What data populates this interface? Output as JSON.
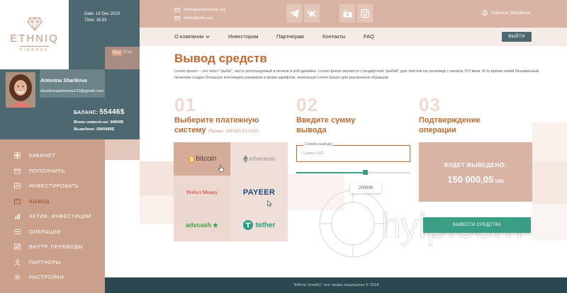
{
  "brand": {
    "name": "ETHNIQ",
    "sub": "FINANCE"
  },
  "session": {
    "date": "Date: 14 Dec 2020",
    "time": "Time: 16:33"
  },
  "lang": {
    "ru": "Rus",
    "en": "Eng"
  },
  "user": {
    "name": "Antonina Sharikova",
    "email": "sharikovaantonina123@gmail.com",
    "balance_label": "БАЛАНС:",
    "balance_value": "55446$",
    "invested": "Всего инвест-но: 94849$",
    "withdrawn": "Выведено: 5945485$"
  },
  "sidebar": {
    "items": [
      {
        "label": "КАБИНЕТ",
        "icon": "grid-icon"
      },
      {
        "label": "ПОПОЛНИТЬ",
        "icon": "deposit-icon"
      },
      {
        "label": "ИНВЕСТИРОВАТЬ",
        "icon": "invest-icon"
      },
      {
        "label": "ВЫВОД",
        "icon": "withdraw-icon"
      },
      {
        "label": "АКТИВ. ИНВЕСТИЦИИ",
        "icon": "chart-icon"
      },
      {
        "label": "ОПЕРАЦИИ",
        "icon": "list-icon"
      },
      {
        "label": "ВНУТР. ПЕРЕВОДЫ",
        "icon": "transfer-icon"
      },
      {
        "label": "ПАРТНЕРЫ",
        "icon": "partners-icon"
      },
      {
        "label": "НАСТРОЙКИ",
        "icon": "settings-icon"
      }
    ]
  },
  "header": {
    "email1": "ethniqjewelrycoinfo.org",
    "email2": "ethniq@info.org",
    "social": [
      "telegram-icon",
      "vk-icon",
      "youtube-icon",
      "instagram-icon"
    ],
    "user_name": "Antonina Sharikova"
  },
  "nav": {
    "items": [
      "О компании",
      "Инвесторам",
      "Партнерам",
      "Контакты",
      "FAQ"
    ],
    "logout": "ВЫЙТИ"
  },
  "page": {
    "title": "Вывод средств",
    "intro": "Lorem Ipsum – это текст-\"рыба\", часто используемый в печати и вэб-дизайне. Lorem Ipsum является стандартной \"рыбой\" для текстов на латинице с начала XVI века. В то время некий безымянный печатник создал большую коллекцию размеров и форм шрифтов, используя Lorem Ipsum для распечатки образцов."
  },
  "steps": [
    {
      "num": "01",
      "title": "Выберите платежную",
      "title2": "систему",
      "hint": "(баланс: 198 801,93 USD)"
    },
    {
      "num": "02",
      "title": "Введите сумму",
      "title2": "вывода"
    },
    {
      "num": "03",
      "title": "Подтверждение",
      "title2": "операции"
    }
  ],
  "payments": [
    "bitcoin",
    "ethereum",
    "Perfect Money",
    "PAYEER",
    "advcash",
    "tether"
  ],
  "amount": {
    "label": "Сумма вывода",
    "placeholder": "Сумма USD",
    "slider_value": "200000",
    "slider_fraction": 0.6
  },
  "result": {
    "label": "БУДЕТ ВЫВЕДЕНО:",
    "amount": "150 000,05",
    "currency": "USD",
    "button": "ВЫВЕСТИ СРЕДСТВА"
  },
  "watermark": "hyip.com",
  "footer": "\"Ethniq Jewelry\" все права защищены © 2018",
  "colors": {
    "teal": "#4d6870",
    "rose": "#d9b3a3",
    "accent": "#c26a2e",
    "green": "#3a9e84",
    "footer": "#2b474f"
  }
}
